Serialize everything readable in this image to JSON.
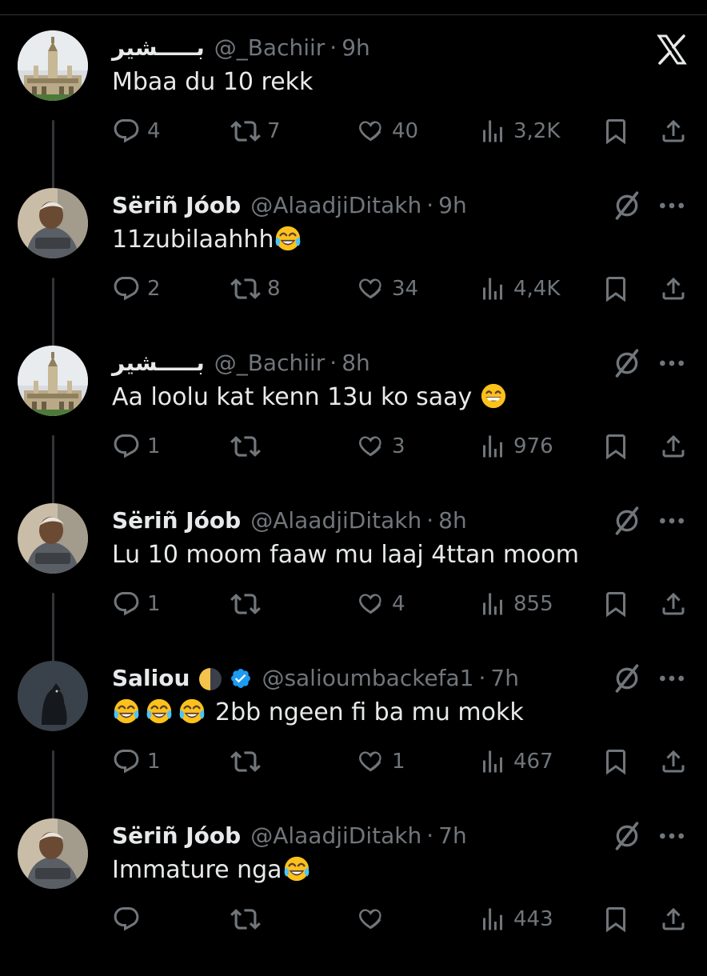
{
  "close_label": "X",
  "tweets": [
    {
      "name": "بـــــشير",
      "handle": "@_Bachiir",
      "time": "9h",
      "text": "Mbaa du 10 rekk",
      "reply": "4",
      "retweet": "7",
      "like": "40",
      "views": "3,2K",
      "avatar": "mosque",
      "text_emoji": ""
    },
    {
      "name": "Sëriñ Jóob",
      "handle": "@AlaadjiDitakh",
      "time": "9h",
      "text": "11zubilaahhh",
      "reply": "2",
      "retweet": "8",
      "like": "34",
      "views": "4,4K",
      "avatar": "man",
      "text_emoji": "tears-of-joy"
    },
    {
      "name": "بـــــشير",
      "handle": "@_Bachiir",
      "time": "8h",
      "text": "Aa loolu kat kenn 13u ko saay",
      "reply": "1",
      "retweet": "",
      "like": "3",
      "views": "976",
      "avatar": "mosque",
      "text_emoji": "grinning"
    },
    {
      "name": "Sëriñ Jóob",
      "handle": "@AlaadjiDitakh",
      "time": "8h",
      "text": "Lu 10 moom faaw mu laaj 4ttan moom",
      "reply": "1",
      "retweet": "",
      "like": "4",
      "views": "855",
      "avatar": "man",
      "text_emoji": ""
    },
    {
      "name": "Saliou",
      "handle": "@salioumbackefa1",
      "time": "7h",
      "text": "2bb ngeen fi ba mu mokk",
      "reply": "1",
      "retweet": "",
      "like": "1",
      "views": "467",
      "avatar": "crow",
      "text_emoji": "tears-of-joy-x3"
    },
    {
      "name": "Sëriñ Jóob",
      "handle": "@AlaadjiDitakh",
      "time": "7h",
      "text": "Immature nga",
      "reply": "",
      "retweet": "",
      "like": "",
      "views": "443",
      "avatar": "man",
      "text_emoji": "tears-of-joy"
    }
  ],
  "colors": {
    "background": "#000000",
    "primary_text": "#e7e9ea",
    "secondary_text": "#71767b",
    "verified_blue": "#1d9bf0",
    "thread_line": "#333639"
  }
}
